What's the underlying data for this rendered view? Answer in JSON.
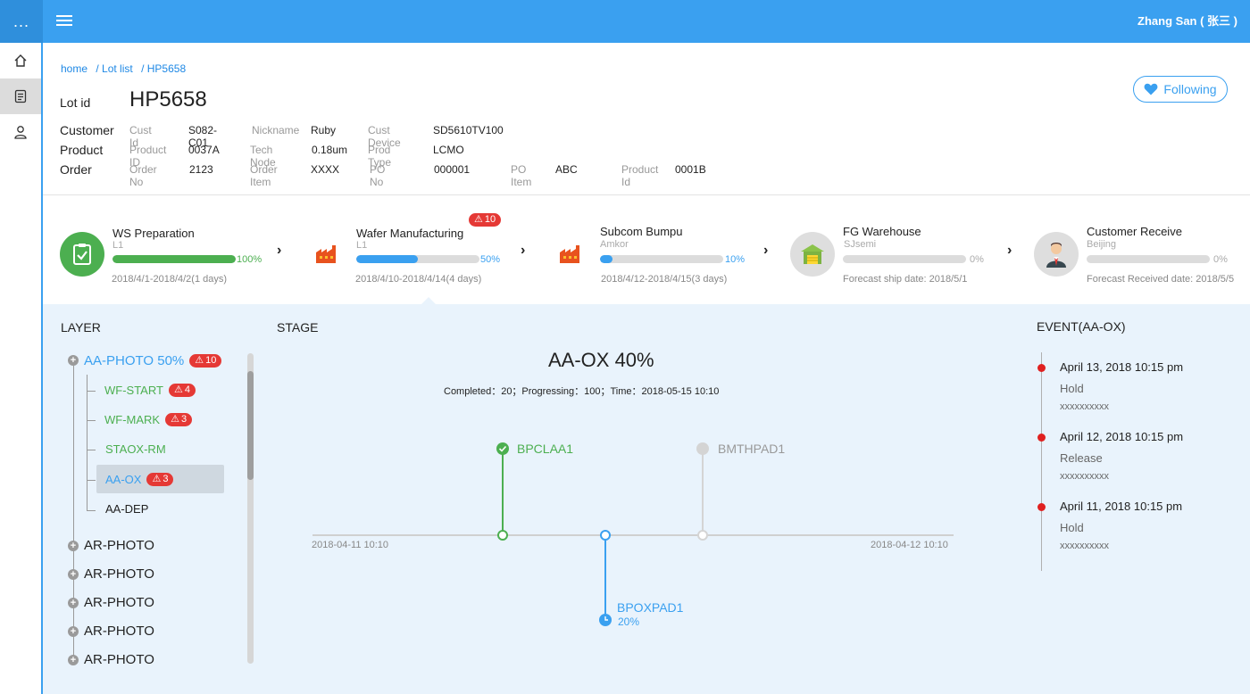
{
  "topbar": {
    "corner": "...",
    "user": "Zhang San ( 张三 )"
  },
  "breadcrumb": [
    "home",
    "/ Lot list",
    "/ HP5658"
  ],
  "lot": {
    "label": "Lot id",
    "id": "HP5658"
  },
  "follow": {
    "label": "Following"
  },
  "info": {
    "customer": {
      "label": "Customer",
      "fields": [
        {
          "k": "Cust Id",
          "v": "S082-C01"
        },
        {
          "k": "Nickname",
          "v": "Ruby"
        },
        {
          "k": "Cust Device",
          "v": "SD5610TV100"
        }
      ]
    },
    "product": {
      "label": "Product",
      "fields": [
        {
          "k": "Product ID",
          "v": "0037A"
        },
        {
          "k": "Tech Node",
          "v": "0.18um"
        },
        {
          "k": "Prod Type",
          "v": "LCMO"
        }
      ]
    },
    "order": {
      "label": "Order",
      "fields": [
        {
          "k": "Order No",
          "v": "2123"
        },
        {
          "k": "Order Item",
          "v": "XXXX"
        },
        {
          "k": "PO No",
          "v": "000001"
        },
        {
          "k": "PO Item",
          "v": "ABC"
        },
        {
          "k": "Product Id",
          "v": "0001B"
        }
      ]
    }
  },
  "steps": [
    {
      "title": "WS Preparation",
      "sub": "L1",
      "progress": 100,
      "pct": "100%",
      "date": "2018/4/1-2018/4/2(1 days)",
      "color": "#4caf50",
      "icon": "checklist-icon"
    },
    {
      "title": "Wafer Manufacturing",
      "sub": "L1",
      "progress": 50,
      "pct": "50%",
      "date": "2018/4/10-2018/4/14(4 days)",
      "color": "#3aa0f0",
      "icon": "factory-icon",
      "alert": "10"
    },
    {
      "title": "Subcom Bumpu",
      "sub": "Amkor",
      "progress": 10,
      "pct": "10%",
      "date": "2018/4/12-2018/4/15(3 days)",
      "color": "#3aa0f0",
      "icon": "factory-icon"
    },
    {
      "title": "FG Warehouse",
      "sub": "SJsemi",
      "progress": 0,
      "pct": "0%",
      "date": "Forecast ship date: 2018/5/1",
      "color": "#aaa",
      "icon": "warehouse-icon"
    },
    {
      "title": "Customer Receive",
      "sub": "Beijing",
      "progress": 0,
      "pct": "0%",
      "date": "Forecast Received date: 2018/5/5",
      "color": "#aaa",
      "icon": "person-icon"
    }
  ],
  "layer": {
    "title": "LAYER",
    "root": {
      "label": "AA-PHOTO 50%",
      "alert": "10"
    },
    "children": [
      {
        "label": "WF-START",
        "alert": "4",
        "color": "#4caf50"
      },
      {
        "label": "WF-MARK",
        "alert": "3",
        "color": "#4caf50"
      },
      {
        "label": "STAOX-RM",
        "color": "#4caf50"
      },
      {
        "label": "AA-OX",
        "alert": "3",
        "color": "#3aa0f0",
        "selected": true
      },
      {
        "label": "AA-DEP",
        "color": "#222"
      }
    ],
    "others": [
      "AR-PHOTO",
      "AR-PHOTO",
      "AR-PHOTO",
      "AR-PHOTO",
      "AR-PHOTO"
    ]
  },
  "stage": {
    "title": "STAGE",
    "name": "AA-OX 40%",
    "summary": "Completed：20；Progressing：100；Time：2018-05-15 10:10",
    "start": "2018-04-11 10:10",
    "end": "2018-04-12 10:10",
    "nodes": [
      {
        "label": "BPCLAA1",
        "state": "done",
        "color": "#4caf50"
      },
      {
        "label": "BMTHPAD1",
        "state": "pending",
        "color": "#999"
      },
      {
        "label": "BPOXPAD1",
        "state": "progress",
        "pct": "20%",
        "color": "#3aa0f0"
      }
    ]
  },
  "events": {
    "title": "EVENT(AA-OX)",
    "items": [
      {
        "date": "April 13, 2018 10:15 pm",
        "status": "Hold",
        "desc": "xxxxxxxxxx"
      },
      {
        "date": "April 12, 2018 10:15 pm",
        "status": "Release",
        "desc": "xxxxxxxxxx"
      },
      {
        "date": "April 11, 2018 10:15 pm",
        "status": "Hold",
        "desc": "xxxxxxxxxx"
      }
    ]
  }
}
